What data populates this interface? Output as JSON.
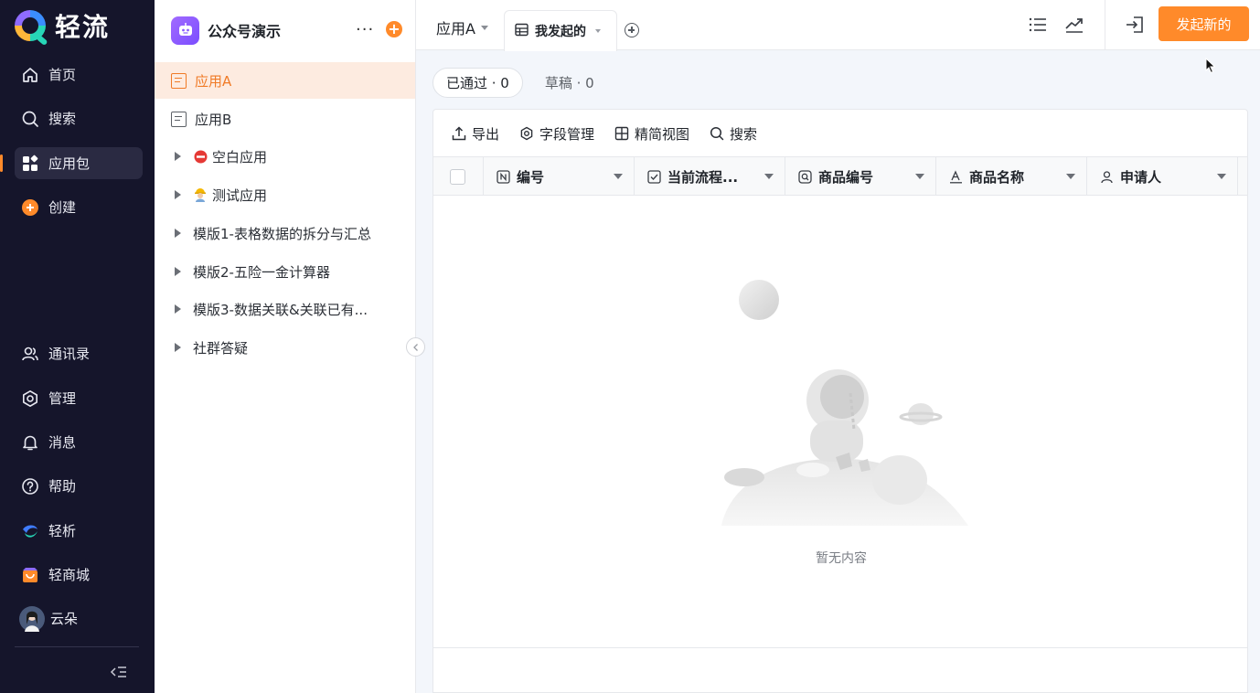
{
  "brand": {
    "name": "轻流"
  },
  "nav": {
    "items": [
      {
        "label": "首页",
        "icon": "home-icon"
      },
      {
        "label": "搜索",
        "icon": "search-icon"
      },
      {
        "label": "应用包",
        "icon": "apps-icon",
        "active": true
      },
      {
        "label": "创建",
        "icon": "plus-circle-icon"
      },
      {
        "label": "通讯录",
        "icon": "contacts-icon"
      },
      {
        "label": "管理",
        "icon": "settings-icon"
      },
      {
        "label": "消息",
        "icon": "bell-icon"
      },
      {
        "label": "帮助",
        "icon": "help-icon"
      },
      {
        "label": "轻析",
        "icon": "qingxi-icon"
      },
      {
        "label": "轻商城",
        "icon": "store-icon"
      },
      {
        "label": "云朵",
        "icon": "avatar"
      }
    ]
  },
  "sidebar": {
    "title": "公众号演示",
    "more": "···",
    "add": "+",
    "items": [
      {
        "label": "应用A",
        "type": "app",
        "active": true
      },
      {
        "label": "应用B",
        "type": "app"
      },
      {
        "label": "空白应用",
        "type": "group",
        "emoji": "no-entry-icon"
      },
      {
        "label": "测试应用",
        "type": "group",
        "emoji": "worker-icon"
      },
      {
        "label": "模版1-表格数据的拆分与汇总",
        "type": "group"
      },
      {
        "label": "模版2-五险一金计算器",
        "type": "group"
      },
      {
        "label": "模版3-数据关联&关联已有...",
        "type": "group"
      },
      {
        "label": "社群答疑",
        "type": "group"
      }
    ]
  },
  "topbar": {
    "app_name": "应用A",
    "tab_label": "我发起的",
    "start_button": "发起新的"
  },
  "status": {
    "approved": "已通过 · 0",
    "draft": "草稿 · 0"
  },
  "toolbar": {
    "export": "导出",
    "fields": "字段管理",
    "view": "精简视图",
    "search": "搜索"
  },
  "table": {
    "columns": [
      {
        "label": "编号",
        "icon": "number-icon"
      },
      {
        "label": "当前流程...",
        "icon": "checkbox-icon"
      },
      {
        "label": "商品编号",
        "icon": "scan-icon"
      },
      {
        "label": "商品名称",
        "icon": "text-icon"
      },
      {
        "label": "申请人",
        "icon": "person-icon"
      }
    ],
    "empty_text": "暂无内容"
  },
  "colors": {
    "accent": "#ff8a2a",
    "nav_bg": "#15152b",
    "active_row": "#fdebe0"
  }
}
